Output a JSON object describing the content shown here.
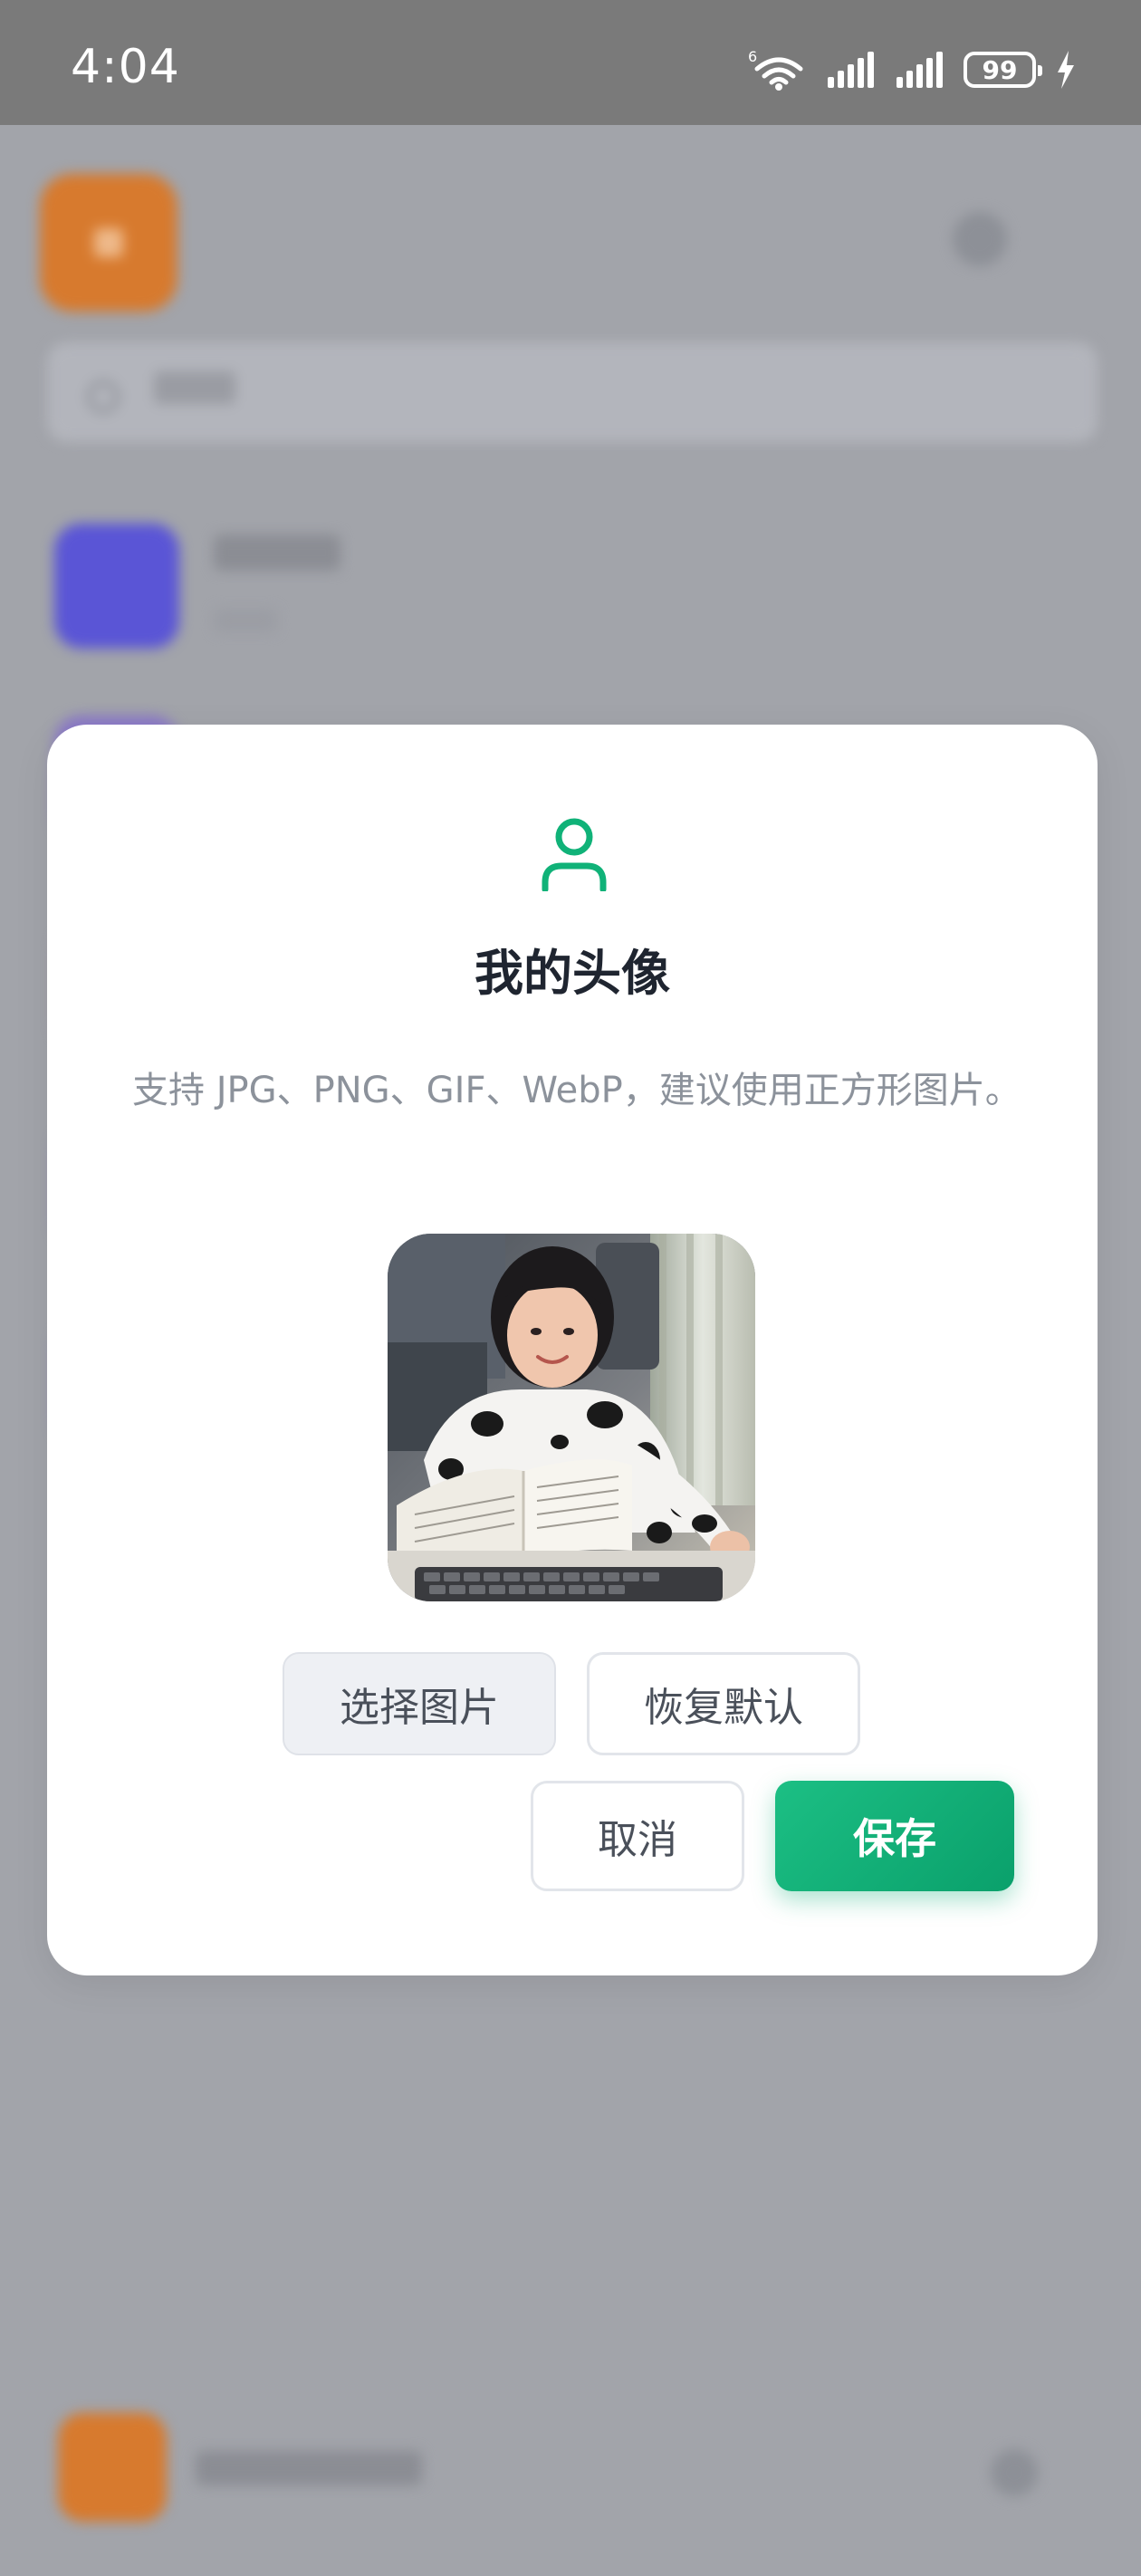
{
  "status_bar": {
    "time": "4:04",
    "battery": "99",
    "network": "6"
  },
  "dialog": {
    "icon": "user-icon",
    "title": "我的头像",
    "description": "支持 JPG、PNG、GIF、WebP，建议使用正方形图片。",
    "buttons": {
      "choose_image": "选择图片",
      "restore_default": "恢复默认",
      "cancel": "取消",
      "save": "保存"
    }
  },
  "colors": {
    "accent": "#10b278",
    "logo": "#d77a2e",
    "title": "#1f2530",
    "muted_text": "#8c929b"
  }
}
